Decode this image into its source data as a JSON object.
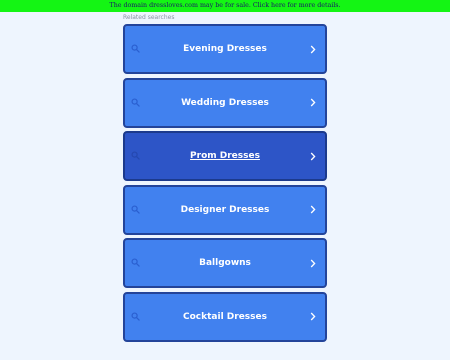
{
  "banner": {
    "text": "The domain dressloves.com may be for sale. Click here for more details."
  },
  "related": {
    "label": "Related searches",
    "items": [
      {
        "label": "Evening Dresses",
        "icon": "search-icon",
        "active": false
      },
      {
        "label": "Wedding Dresses",
        "icon": "search-icon",
        "active": false
      },
      {
        "label": "Prom Dresses",
        "icon": "search-icon",
        "active": true
      },
      {
        "label": "Designer Dresses",
        "icon": "search-icon",
        "active": false
      },
      {
        "label": "Ballgowns",
        "icon": "search-icon",
        "active": false
      },
      {
        "label": "Cocktail Dresses",
        "icon": "search-icon",
        "active": false
      }
    ]
  },
  "colors": {
    "banner_bg": "#14f514",
    "page_bg": "#eef5fe",
    "button_bg": "#4181ef",
    "button_active_bg": "#2d55c7",
    "button_border": "#23449a"
  }
}
